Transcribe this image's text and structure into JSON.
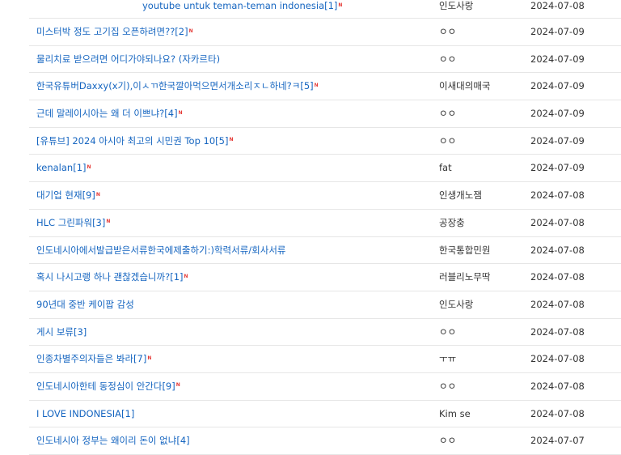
{
  "posts": [
    {
      "title": "youtube untuk teman-teman indonesia",
      "comments": "[1]",
      "new": true,
      "author": "인도사랑",
      "date": "2024-07-08"
    },
    {
      "title": "미스터박 정도 고기집 오픈하려면??",
      "comments": "[2]",
      "new": true,
      "author": "ㅇㅇ",
      "date": "2024-07-09"
    },
    {
      "title": "물리치료 받으려면 어디가야되나요? (자카르타)",
      "comments": "",
      "new": false,
      "author": "ㅇㅇ",
      "date": "2024-07-09"
    },
    {
      "title": "한국유튜버Daxxy(x기),이ㅅㄲ한국깔아먹으면서개소리ㅈㄴ하네?ㅋ",
      "comments": "[5]",
      "new": true,
      "author": "이새대의매국",
      "date": "2024-07-09"
    },
    {
      "title": "근데 말레이시아는 왜 더 이쁘냐?",
      "comments": "[4]",
      "new": true,
      "author": "ㅇㅇ",
      "date": "2024-07-09"
    },
    {
      "title": "[유튜브] 2024 아시아 최고의 시민권 Top 10",
      "comments": "[5]",
      "new": true,
      "author": "ㅇㅇ",
      "date": "2024-07-09"
    },
    {
      "title": "kenalan",
      "comments": "[1]",
      "new": true,
      "author": "fat",
      "date": "2024-07-09"
    },
    {
      "title": "대기업 현재",
      "comments": "[9]",
      "new": true,
      "author": "인생개노잼",
      "date": "2024-07-08"
    },
    {
      "title": "HLC 그린파워",
      "comments": "[3]",
      "new": true,
      "author": "공장충",
      "date": "2024-07-08"
    },
    {
      "title": "인도네시아에서발급받은서류한국에제출하기:)학력서류/회사서류",
      "comments": "",
      "new": false,
      "author": "한국통합민원",
      "date": "2024-07-08"
    },
    {
      "title": "혹시 나시고랭 하나 괜찮겠습니까?",
      "comments": "[1]",
      "new": true,
      "author": "러블리노무딱",
      "date": "2024-07-08"
    },
    {
      "title": "90년대 중반 케이팝 감성",
      "comments": "",
      "new": false,
      "author": "인도사랑",
      "date": "2024-07-08"
    },
    {
      "title": "게시 보류",
      "comments": "[3]",
      "new": false,
      "author": "ㅇㅇ",
      "date": "2024-07-08"
    },
    {
      "title": "인종차별주의자들은 봐라",
      "comments": "[7]",
      "new": true,
      "author": "ㅜㅠ",
      "date": "2024-07-08"
    },
    {
      "title": "인도네시아한테 동정심이 안간다",
      "comments": "[9]",
      "new": true,
      "author": "ㅇㅇ",
      "date": "2024-07-08"
    },
    {
      "title": "I LOVE INDONESIA",
      "comments": "[1]",
      "new": false,
      "author": "Kim se",
      "date": "2024-07-08"
    },
    {
      "title": "인도네시아 정부는 왜이리 돈이 없냐",
      "comments": "[4]",
      "new": false,
      "author": "ㅇㅇ",
      "date": "2024-07-07"
    }
  ],
  "new_mark": "N",
  "colors": {
    "link": "#1565c0",
    "new_mark": "#e53935",
    "divider": "#e6e6e6"
  }
}
